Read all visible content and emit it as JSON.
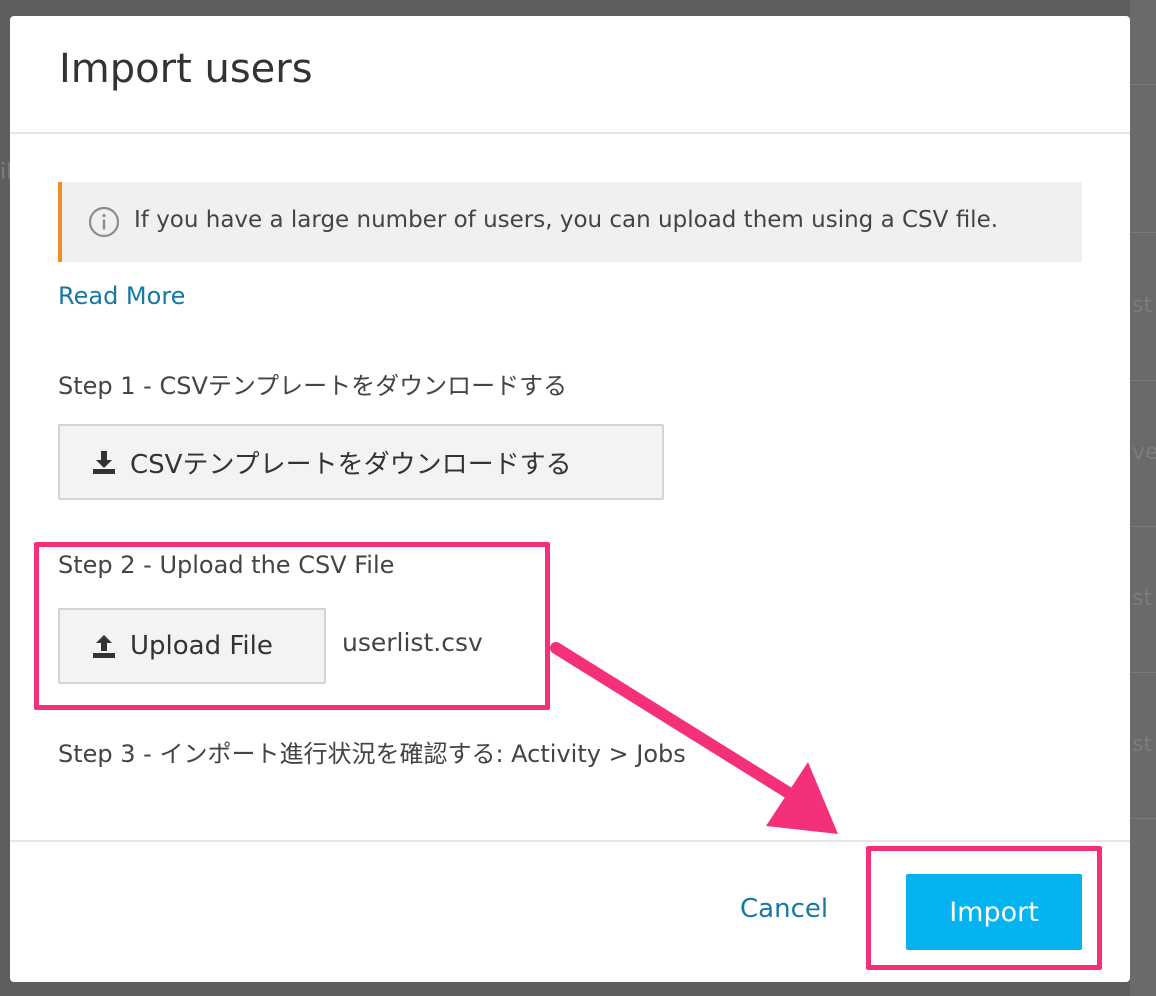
{
  "dialog": {
    "title": "Import users",
    "info_text": "If you have a large number of users, you can upload them using a CSV file.",
    "read_more": "Read More",
    "step1_label": "Step 1 - CSVテンプレートをダウンロードする",
    "download_button": "CSVテンプレートをダウンロードする",
    "step2_label": "Step 2 - Upload the CSV File",
    "upload_button": "Upload File",
    "file_name": "userlist.csv",
    "step3_label": "Step 3 - インポート進行状況を確認する: Activity > Jobs",
    "cancel_button": "Cancel",
    "import_button": "Import"
  },
  "background": {
    "fragments": [
      "il",
      "st l",
      "ver",
      "st l",
      "st l"
    ]
  },
  "colors": {
    "accent_link": "#1678a6",
    "primary_button": "#03b4f0",
    "info_border": "#f28c28",
    "annotation": "#f5307a"
  },
  "icons": {
    "info": "info-circle-icon",
    "download": "download-icon",
    "upload": "upload-icon"
  }
}
